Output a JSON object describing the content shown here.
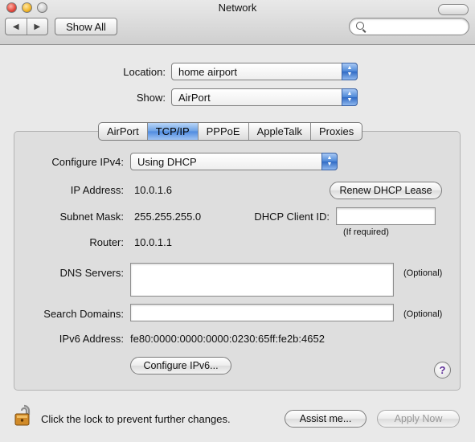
{
  "window": {
    "title": "Network"
  },
  "toolbar": {
    "back_glyph": "◀",
    "forward_glyph": "▶",
    "show_all_label": "Show All",
    "search_placeholder": "",
    "search_icon": "magnifying-glass-icon"
  },
  "location": {
    "label": "Location:",
    "value": "home airport"
  },
  "show": {
    "label": "Show:",
    "value": "AirPort"
  },
  "tabs": [
    {
      "label": "AirPort",
      "active": false
    },
    {
      "label": "TCP/IP",
      "active": true
    },
    {
      "label": "PPPoE",
      "active": false
    },
    {
      "label": "AppleTalk",
      "active": false
    },
    {
      "label": "Proxies",
      "active": false
    }
  ],
  "tcpip": {
    "configure_label": "Configure IPv4:",
    "configure_value": "Using DHCP",
    "ip_label": "IP Address:",
    "ip_value": "10.0.1.6",
    "renew_label": "Renew DHCP Lease",
    "subnet_label": "Subnet Mask:",
    "subnet_value": "255.255.255.0",
    "client_id_label": "DHCP Client ID:",
    "client_id_value": "",
    "if_required": "(If required)",
    "router_label": "Router:",
    "router_value": "10.0.1.1",
    "dns_label": "DNS Servers:",
    "dns_value": "",
    "dns_optional": "(Optional)",
    "search_domains_label": "Search Domains:",
    "search_domains_value": "",
    "search_domains_optional": "(Optional)",
    "ipv6_label": "IPv6 Address:",
    "ipv6_value": "fe80:0000:0000:0000:0230:65ff:fe2b:4652",
    "configure_ipv6_label": "Configure IPv6...",
    "help_glyph": "?"
  },
  "footer": {
    "lock_text": "Click the lock to prevent further changes.",
    "assist_label": "Assist me...",
    "apply_label": "Apply Now"
  },
  "colors": {
    "accent": "#4f8be0",
    "help": "#5b2a95"
  }
}
